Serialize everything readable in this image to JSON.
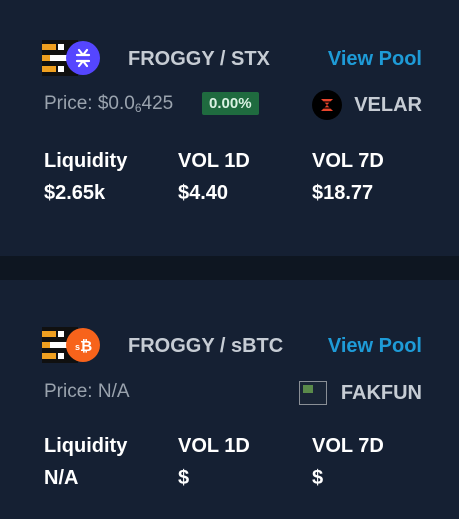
{
  "pools": [
    {
      "pair": "FROGGY / STX",
      "view_pool_label": "View Pool",
      "price_prefix": "Price: $0.0",
      "price_subscript": "6",
      "price_suffix": "425",
      "change": "0.00%",
      "dex": "VELAR",
      "stats": [
        {
          "label": "Liquidity",
          "value": "$2.65k"
        },
        {
          "label": "VOL 1D",
          "value": "$4.40"
        },
        {
          "label": "VOL 7D",
          "value": "$18.77"
        }
      ]
    },
    {
      "pair": "FROGGY / sBTC",
      "view_pool_label": "View Pool",
      "price": "Price: N/A",
      "dex": "FAKFUN",
      "stats": [
        {
          "label": "Liquidity",
          "value": "N/A"
        },
        {
          "label": "VOL 1D",
          "value": "$"
        },
        {
          "label": "VOL 7D",
          "value": "$"
        }
      ]
    }
  ],
  "icons": {
    "base_token": "froggy-token-icon",
    "stx": "stx-token-icon",
    "sbtc": "sbtc-token-icon",
    "velar": "velar-dex-icon",
    "fakfun": "fakfun-dex-icon"
  },
  "colors": {
    "background": "#0e1621",
    "card": "#152033",
    "accent_link": "#1e9bd7",
    "badge_green": "#1f6b3f",
    "stx_purple": "#5546ff",
    "sbtc_orange": "#f7631b"
  }
}
